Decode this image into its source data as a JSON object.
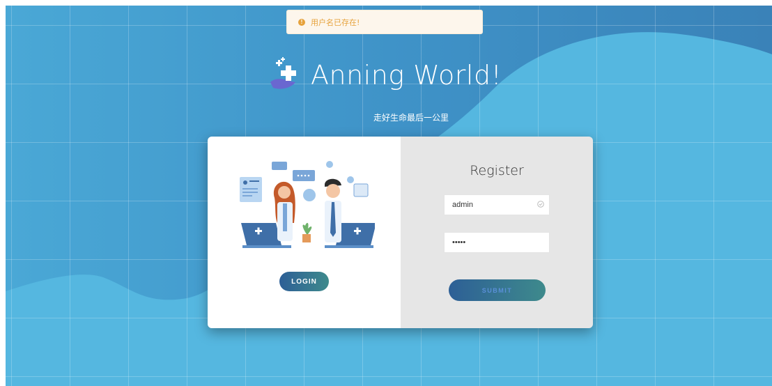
{
  "toast": {
    "icon": "warning-icon",
    "message": "用户名已存在!",
    "color": "#e6a23c"
  },
  "header": {
    "logo_icon": "medical-cross-hand-icon",
    "title": "Anning World!",
    "subtitle": "走好生命最后一公里"
  },
  "login_panel": {
    "illustration": "doctors-video-call-illustration",
    "button_label": "LOGIN"
  },
  "register_panel": {
    "title": "Register",
    "username_value": "admin",
    "password_value": "•••••",
    "submit_label": "SUBMIT"
  },
  "colors": {
    "background": "#3b8fc6",
    "wave": "#55b7e0",
    "button_start": "#2d5f96",
    "button_end": "#3e8a8c"
  }
}
